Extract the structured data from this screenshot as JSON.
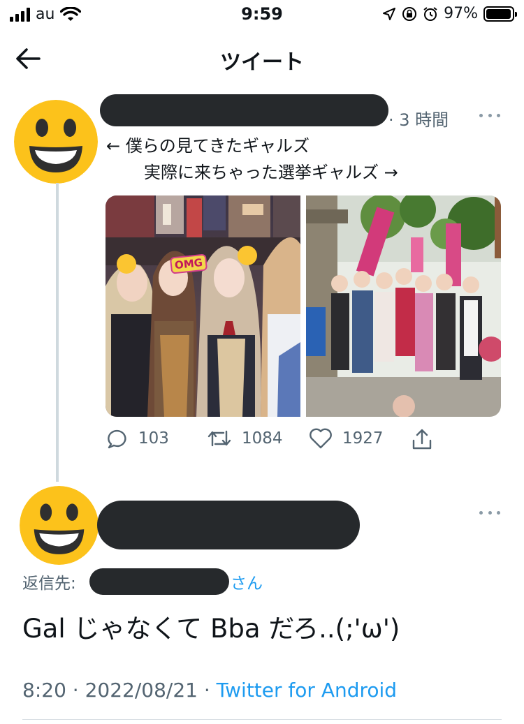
{
  "status_bar": {
    "carrier": "au",
    "time": "9:59",
    "battery": "97%",
    "battery_fraction": 0.97
  },
  "header": {
    "title": "ツイート"
  },
  "tweet": {
    "time_ago": "· 3 時間",
    "text_line1": "← 僕らの見てきたギャルズ",
    "text_line2": "実際に来ちゃった選挙ギャルズ →",
    "media": {
      "photo1_sticker": "OMG"
    },
    "replies": "103",
    "retweets": "1084",
    "likes": "1927"
  },
  "reply": {
    "reply_to_label": "返信先:",
    "reply_to_suffix": "さん",
    "text": "Gal じゃなくて Bba だろ..(;'ω')",
    "time": "8:20 · 2022/08/21 ·",
    "source": "Twitter for Android"
  },
  "colors": {
    "accent": "#1d9bf0",
    "secondary_text": "#536471",
    "redaction": "#26292c",
    "avatar": "#fcc21b"
  }
}
